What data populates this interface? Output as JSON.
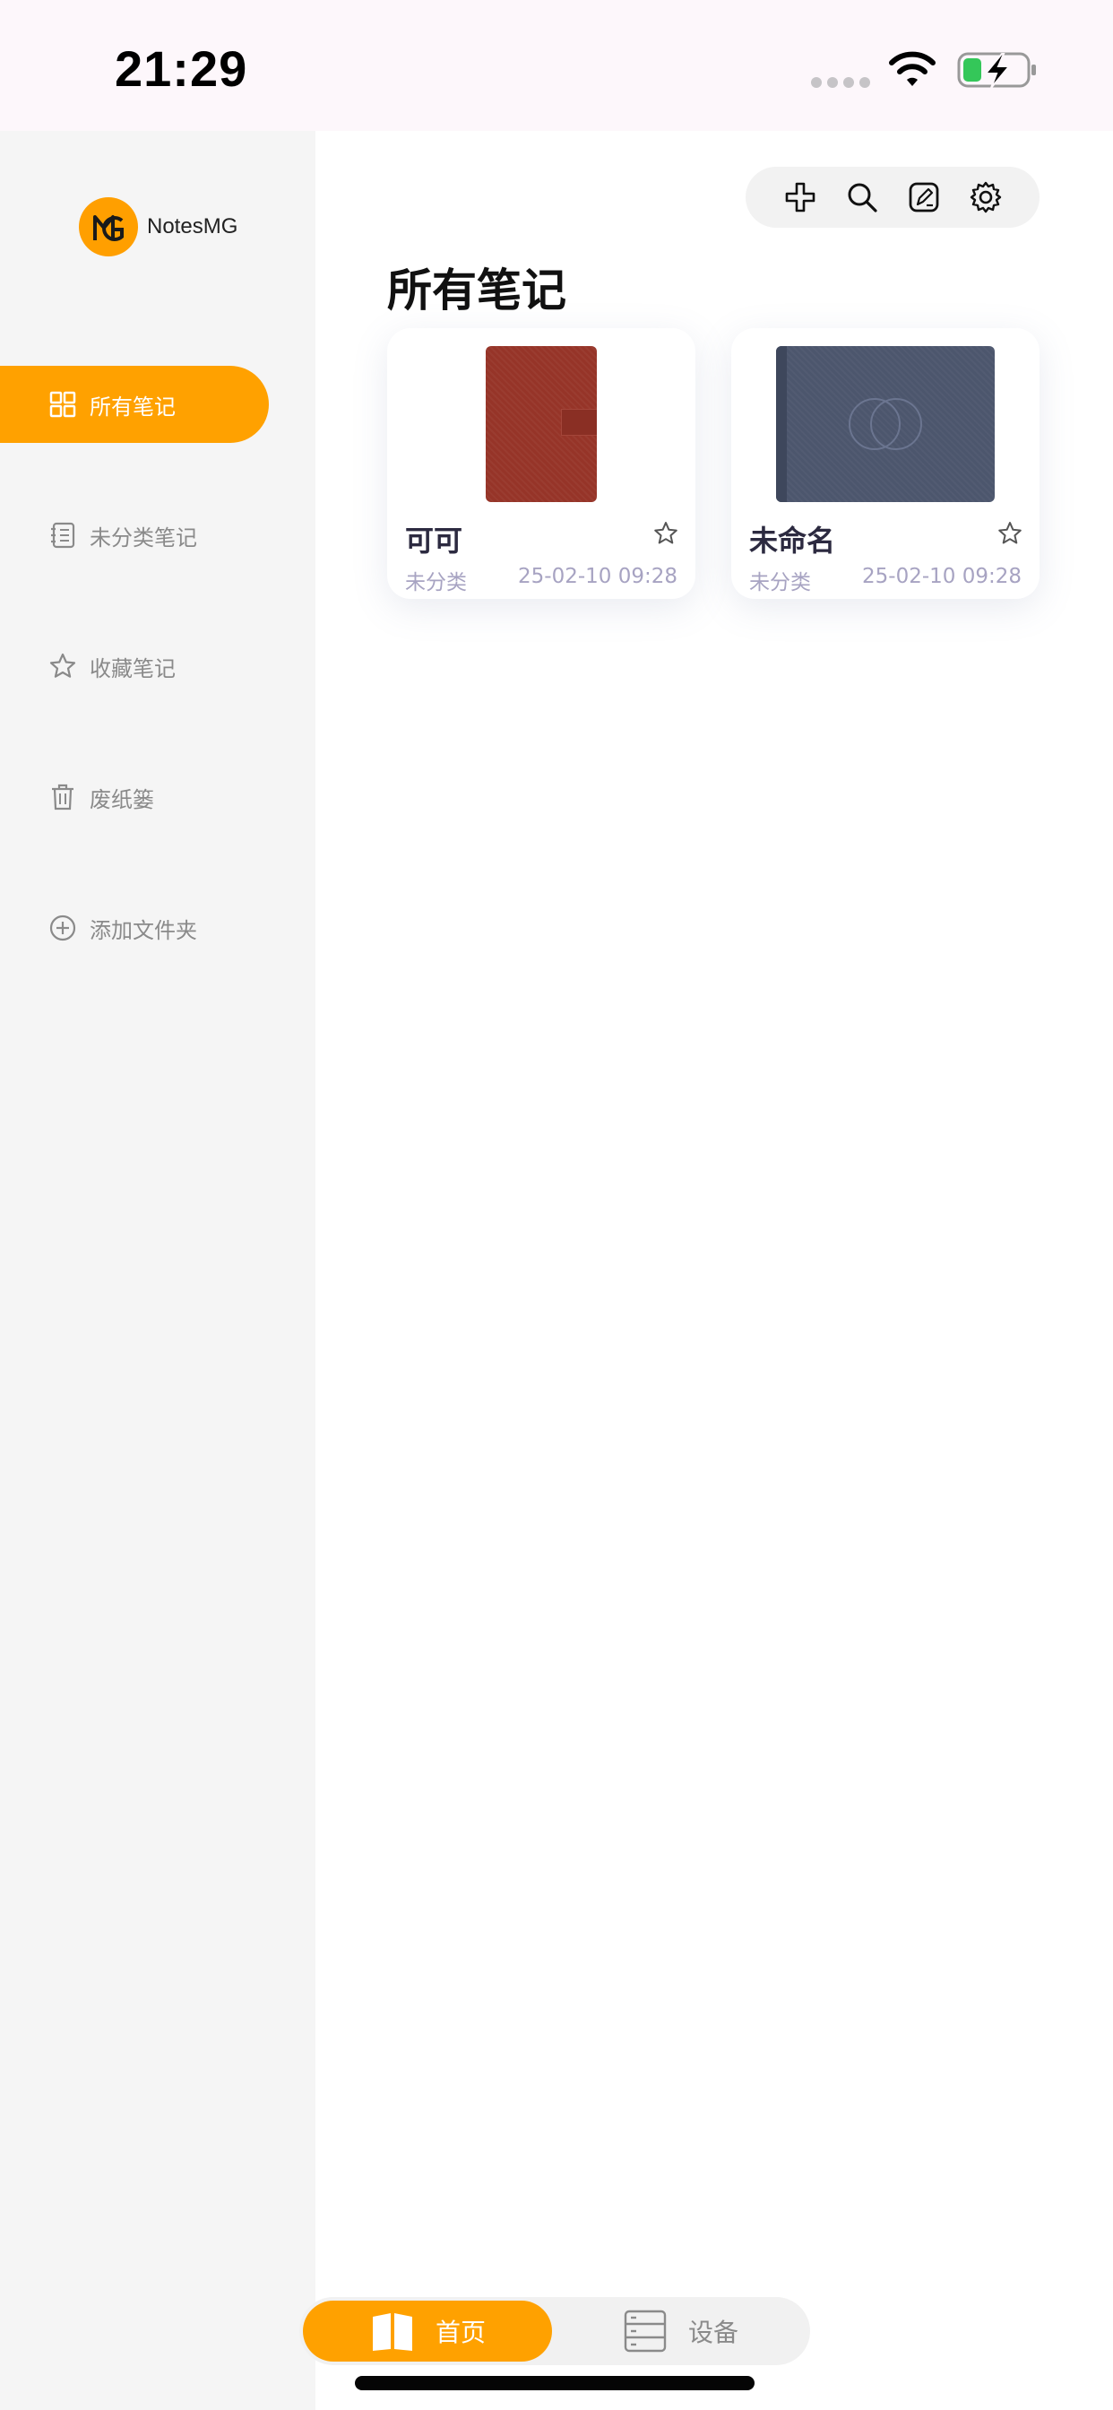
{
  "status_bar": {
    "time": "21:29",
    "icons": [
      "signal-dots-icon",
      "wifi-icon",
      "battery-charging-icon"
    ],
    "battery_color": "#34c759"
  },
  "sidebar": {
    "brand": "NotesMG",
    "items": [
      {
        "label": "所有笔记",
        "icon": "grid-icon",
        "active": true
      },
      {
        "label": "未分类笔记",
        "icon": "notebook-icon",
        "active": false
      },
      {
        "label": "收藏笔记",
        "icon": "star-icon",
        "active": false
      },
      {
        "label": "废纸篓",
        "icon": "trash-icon",
        "active": false
      },
      {
        "label": "添加文件夹",
        "icon": "plus-circle-icon",
        "active": false
      }
    ]
  },
  "toolbar": {
    "icons": [
      "plus-icon",
      "search-icon",
      "edit-icon",
      "gear-icon"
    ]
  },
  "main": {
    "title": "所有笔记",
    "notes": [
      {
        "title": "可可",
        "category": "未分类",
        "date": "25-02-10 09:28",
        "cover": "red"
      },
      {
        "title": "未命名",
        "category": "未分类",
        "date": "25-02-10 09:28",
        "cover": "blue"
      }
    ]
  },
  "tabbar": {
    "home": "首页",
    "device": "设备"
  },
  "colors": {
    "accent": "#ffa100",
    "sidebar_bg": "#f5f5f5",
    "meta_text": "#a7a3c2"
  }
}
